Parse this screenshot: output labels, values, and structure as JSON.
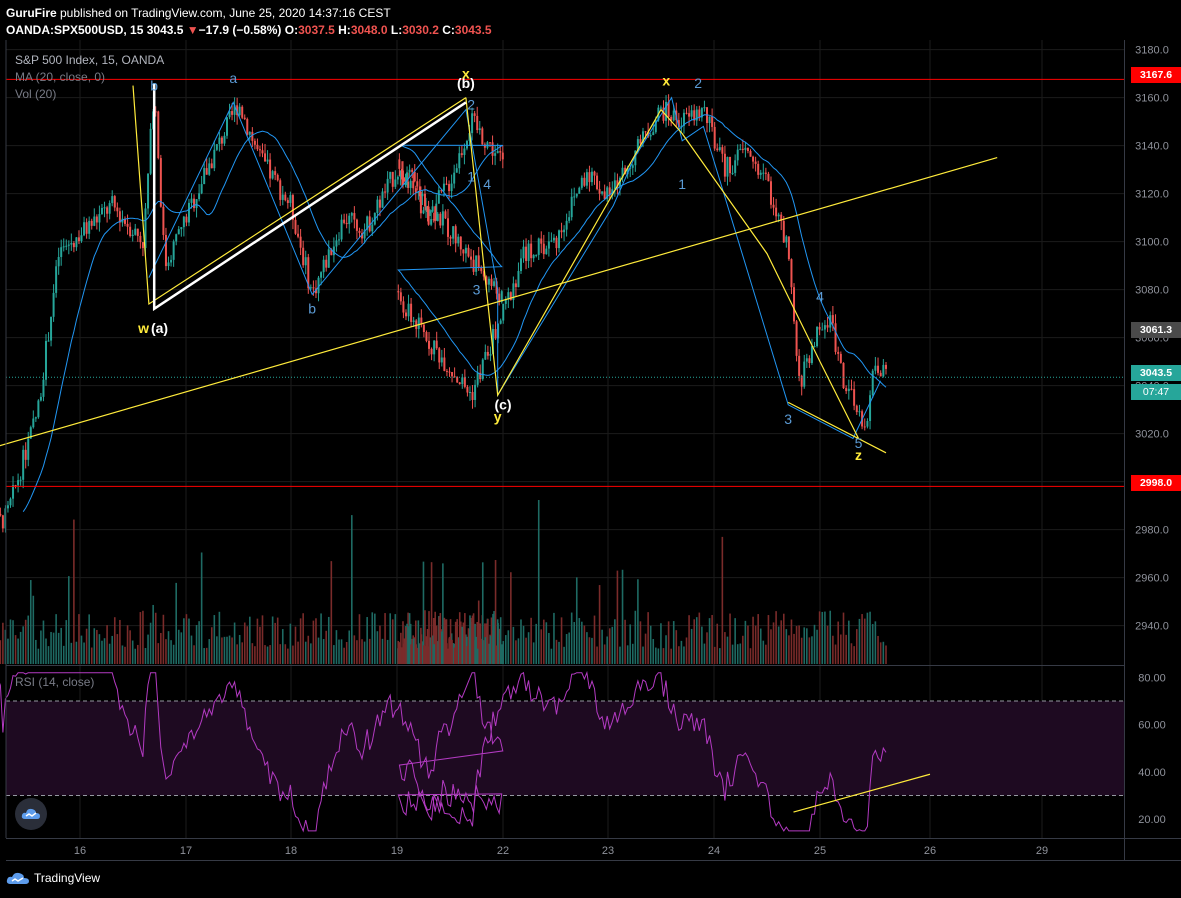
{
  "header": {
    "line1_author": "GuruFire",
    "line1_rest": " published on TradingView.com, June 25, 2020 14:37:16 CEST",
    "symbol": "OANDA:SPX500USD, 15",
    "last": "3043.5",
    "change": "−17.9 (−0.58%)",
    "o_label": "O:",
    "o": "3037.5",
    "h_label": "H:",
    "h": "3048.0",
    "l_label": "L:",
    "l": "3030.2",
    "c_label": "C:",
    "c": "3043.5"
  },
  "legend": {
    "title": "S&P 500 Index, 15, OANDA",
    "ma": "MA (20, close, 0)",
    "vol": "Vol (20)",
    "rsi": "RSI (14, close)"
  },
  "badges": {
    "upper": "3167.6",
    "mid": "3061.3",
    "last": "3043.5",
    "countdown": "07:47",
    "lower": "2998.0"
  },
  "footer": {
    "brand": "TradingView"
  },
  "colors": {
    "bull": "#26a69a",
    "bear": "#ef5350",
    "ma": "#2196f3",
    "wave": "#ffeb3b",
    "white_wave": "#ffffff",
    "hline": "#ff0000",
    "rsi": "#9c27b0",
    "grid": "#1b1b1b"
  },
  "chart_data": [
    {
      "type": "candlestick",
      "title": "S&P 500 Index, 15, OANDA",
      "x_ticks": [
        "16",
        "17",
        "18",
        "19",
        "22",
        "23",
        "24",
        "25",
        "26",
        "29"
      ],
      "y_ticks": [
        "2940.0",
        "2960.0",
        "2980.0",
        "3000.0",
        "3020.0",
        "3040.0",
        "3060.0",
        "3080.0",
        "3100.0",
        "3120.0",
        "3140.0",
        "3160.0",
        "3180.0"
      ],
      "ylim": [
        2924,
        3184
      ],
      "path_anchors": {
        "x": [
          "15",
          "15.3",
          "15.6",
          "15.8",
          "16.3",
          "16.6",
          "16.7",
          "16.8",
          "17.2",
          "17.5",
          "17.7",
          "18.0",
          "18.2",
          "18.5",
          "18.7",
          "19.0",
          "19.3",
          "19.5",
          "19.7",
          "21.7",
          "22.0",
          "22.2",
          "22.5",
          "22.8",
          "23.0",
          "23.3",
          "23.5",
          "23.7",
          "23.9",
          "24.1",
          "24.3",
          "24.5",
          "24.7",
          "24.8",
          "24.95",
          "25.1",
          "25.2",
          "25.4",
          "25.5",
          "25.6"
        ],
        "price": [
          2978,
          2985,
          3030,
          3095,
          3115,
          3100,
          3165,
          3090,
          3130,
          3158,
          3135,
          3115,
          3078,
          3110,
          3105,
          3130,
          3110,
          3125,
          3150,
          3036,
          3070,
          3095,
          3100,
          3130,
          3118,
          3140,
          3155,
          3150,
          3155,
          3130,
          3138,
          3125,
          3095,
          3040,
          3060,
          3068,
          3045,
          3020,
          3050,
          3043.5
        ]
      },
      "horizontal_lines": [
        3167.6,
        2998.0
      ],
      "current_price": 3043.5,
      "annotations": [
        {
          "text": "b",
          "x": "16.7",
          "price": 3163,
          "color": "#5b9bd5"
        },
        {
          "text": "a",
          "x": "17.45",
          "price": 3166,
          "color": "#5b9bd5"
        },
        {
          "text": "(b)",
          "x": "19.65",
          "price": 3164,
          "color": "#ffffff"
        },
        {
          "text": "x",
          "x": "19.65",
          "price": 3168,
          "color": "#ffeb3b"
        },
        {
          "text": "2",
          "x": "19.7",
          "price": 3155,
          "color": "#5b9bd5"
        },
        {
          "text": "1",
          "x": "19.7",
          "price": 3125,
          "color": "#5b9bd5"
        },
        {
          "text": "4",
          "x": "21.85",
          "price": 3122,
          "color": "#5b9bd5"
        },
        {
          "text": "3",
          "x": "21.75",
          "price": 3078,
          "color": "#5b9bd5"
        },
        {
          "text": "b",
          "x": "18.2",
          "price": 3070,
          "color": "#5b9bd5"
        },
        {
          "text": "w",
          "x": "16.6",
          "price": 3062,
          "color": "#ffeb3b"
        },
        {
          "text": "(a)",
          "x": "16.75",
          "price": 3062,
          "color": "#ffffff"
        },
        {
          "text": "(c)",
          "x": "22.0",
          "price": 3030,
          "color": "#ffffff"
        },
        {
          "text": "y",
          "x": "21.95",
          "price": 3025,
          "color": "#ffeb3b"
        },
        {
          "text": "x",
          "x": "23.55",
          "price": 3165,
          "color": "#ffeb3b"
        },
        {
          "text": "2",
          "x": "23.85",
          "price": 3164,
          "color": "#5b9bd5"
        },
        {
          "text": "1",
          "x": "23.7",
          "price": 3122,
          "color": "#5b9bd5"
        },
        {
          "text": "4",
          "x": "25.0",
          "price": 3075,
          "color": "#5b9bd5"
        },
        {
          "text": "3",
          "x": "24.7",
          "price": 3024,
          "color": "#5b9bd5"
        },
        {
          "text": "5",
          "x": "25.35",
          "price": 3014,
          "color": "#5b9bd5"
        },
        {
          "text": "z",
          "x": "25.35",
          "price": 3009,
          "color": "#ffeb3b"
        }
      ],
      "wave_lines": {
        "yellow": [
          [
            [
              "16.5",
              3165
            ],
            [
              "16.65",
              3074
            ],
            [
              "19.65",
              3160
            ]
          ],
          [
            [
              "19.65",
              3160
            ],
            [
              "21.95",
              3036
            ],
            [
              "23.5",
              3155
            ],
            [
              "23.7",
              3145
            ],
            [
              "24.5",
              3095
            ],
            [
              "25.0",
              3050
            ],
            [
              "25.35",
              3018
            ]
          ],
          [
            [
              "24.7",
              3033
            ],
            [
              "25.6",
              3012
            ]
          ],
          [
            [
              "15.0",
              3012
            ],
            [
              "28.6",
              3135
            ]
          ]
        ],
        "white": [
          [
            [
              "16.7",
              3166
            ],
            [
              "16.7",
              3072
            ],
            [
              "19.65",
              3158
            ]
          ]
        ],
        "blue": [
          [
            [
              "16.65",
              3085
            ],
            [
              "17.45",
              3158
            ],
            [
              "18.2",
              3078
            ],
            [
              "19.65",
              3155
            ],
            [
              "19.95",
              3080
            ],
            [
              "21.95",
              3036
            ],
            [
              "23.05",
              3115
            ],
            [
              "23.25",
              3135
            ],
            [
              "23.6",
              3160
            ],
            [
              "23.7",
              3142
            ],
            [
              "23.9",
              3148
            ],
            [
              "24.7",
              3032
            ],
            [
              "25.3",
              3018
            ],
            [
              "25.55",
              3042
            ]
          ]
        ]
      }
    },
    {
      "type": "bar",
      "title": "Vol (20)",
      "note": "volume histogram below price panel"
    },
    {
      "type": "line",
      "title": "RSI (14, close)",
      "y_ticks": [
        "20.00",
        "40.00",
        "60.00",
        "80.00"
      ],
      "ylim": [
        12,
        84
      ],
      "bands": [
        70,
        30
      ],
      "trendline": [
        [
          "24.75",
          23
        ],
        [
          "26.0",
          39
        ]
      ]
    }
  ]
}
